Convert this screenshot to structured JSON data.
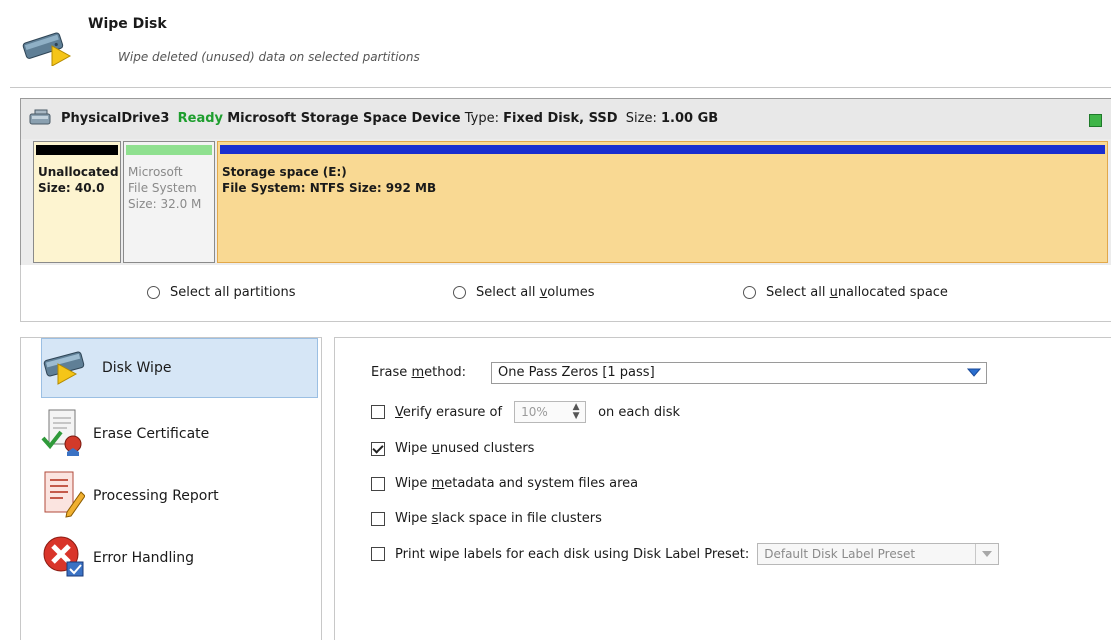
{
  "header": {
    "title": "Wipe Disk",
    "subtitle": "Wipe deleted (unused) data on selected partitions",
    "icon": "disk-wipe-icon"
  },
  "disk": {
    "name": "PhysicalDrive3",
    "status": "Ready",
    "model": "Microsoft Storage Space Device",
    "type_label": "Type:",
    "type_value": "Fixed Disk, SSD",
    "size_label": "Size:",
    "size_value": "1.00 GB",
    "status_color": "#3fb548",
    "partitions": [
      {
        "line1": "Unallocated",
        "line2": "Size: 40.0",
        "bar_color": "#000000",
        "fill": "#fdf4d0"
      },
      {
        "line1": "Microsoft",
        "line2": "File System",
        "line3": "Size: 32.0 M",
        "bar_color": "#8fe08f",
        "fill": "#f3f3f3"
      },
      {
        "line1": "Storage space (E:)",
        "line2": "File System: NTFS Size: 992 MB",
        "bar_color": "#1a2fcf",
        "fill": "#f9d993"
      }
    ]
  },
  "selection": {
    "all_partitions": "Select all partitions",
    "all_volumes_pre": "Select all ",
    "all_volumes_u": "v",
    "all_volumes_post": "olumes",
    "all_unalloc_pre": "Select all ",
    "all_unalloc_u": "u",
    "all_unalloc_post": "nallocated space"
  },
  "nav": {
    "items": [
      {
        "label": "Disk Wipe",
        "icon": "disk-wipe-icon",
        "selected": true
      },
      {
        "label": "Erase Certificate",
        "icon": "certificate-icon",
        "selected": false
      },
      {
        "label": "Processing Report",
        "icon": "report-icon",
        "selected": false
      },
      {
        "label": "Error Handling",
        "icon": "error-icon",
        "selected": false
      }
    ]
  },
  "options": {
    "erase_method_pre": "Erase ",
    "erase_method_u": "m",
    "erase_method_post": "ethod:",
    "erase_method_value": "One Pass Zeros [1 pass]",
    "verify_u": "V",
    "verify_post": "erify erasure of",
    "verify_value": "10%",
    "verify_suffix": "on each disk",
    "verify_checked": false,
    "unused_pre": "Wipe ",
    "unused_u": "u",
    "unused_post": "nused clusters",
    "unused_checked": true,
    "metadata_pre": "Wipe ",
    "metadata_u": "m",
    "metadata_post": "etadata and system files area",
    "metadata_checked": false,
    "slack_pre": "Wipe ",
    "slack_u": "s",
    "slack_post": "lack space in file clusters",
    "slack_checked": false,
    "labels_text": "Print wipe labels for each disk using Disk Label Preset:",
    "labels_checked": false,
    "preset_value": "Default Disk Label Preset"
  },
  "colors": {
    "accent_selected": "#d6e6f6",
    "ready_green": "#1e9e2e",
    "dropdown_arrow": "#2a6fcf"
  }
}
